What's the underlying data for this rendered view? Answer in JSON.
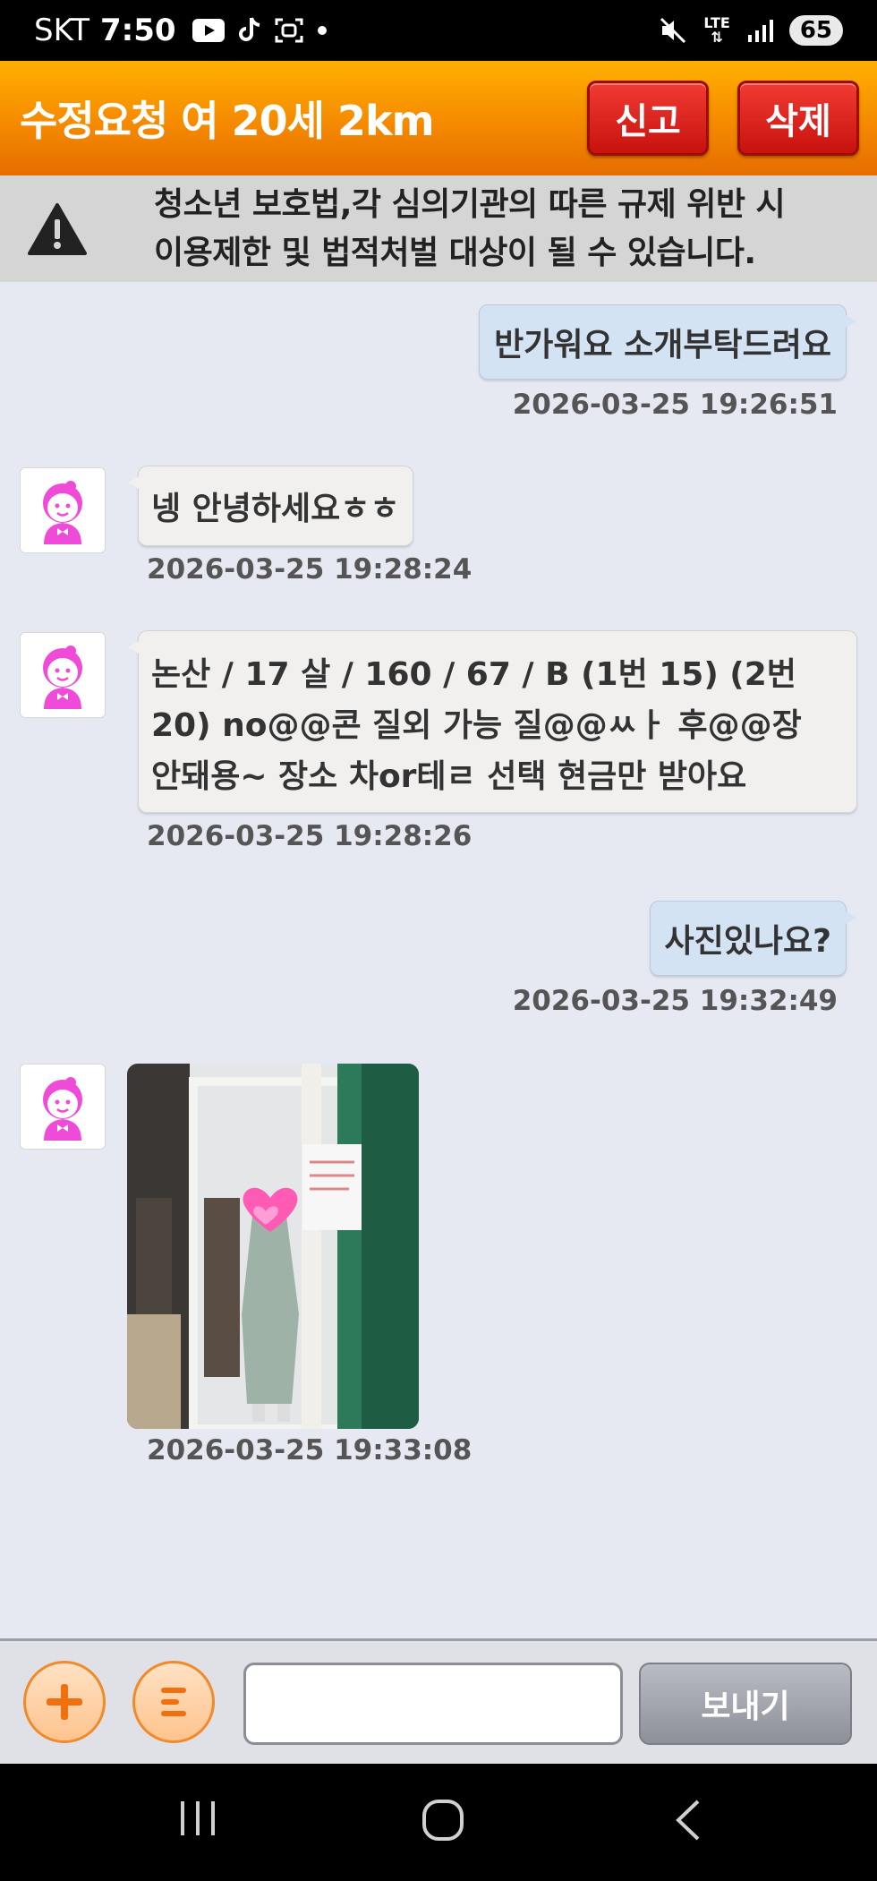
{
  "statusbar": {
    "carrier": "SKT",
    "time": "7:50",
    "network": "LTE",
    "battery": "65"
  },
  "header": {
    "title": "수정요청 여 20세 2km",
    "report_label": "신고",
    "delete_label": "삭제"
  },
  "warning": {
    "line1": "청소년 보호법,각 심의기관의 따른 규제 위반 시",
    "line2": "이용제한 및 법적처벌 대상이 될 수  있습니다."
  },
  "messages": [
    {
      "side": "sent",
      "text": "반가워요 소개부탁드려요",
      "time": "2026-03-25 19:26:51"
    },
    {
      "side": "received",
      "text": "넹 안녕하세요ㅎㅎ",
      "time": "2026-03-25 19:28:24"
    },
    {
      "side": "received",
      "lines": [
        "논산 / 17 살 / 160 / 67 / B (1번 15) (2번",
        "20) no@@콘 질외 가능 질@@ㅆㅏ 후@@장",
        "안돼용~ 장소 차or테ㄹ 선택 현금만 받아요"
      ],
      "time": "2026-03-25 19:28:26"
    },
    {
      "side": "sent",
      "text": "사진있나요?",
      "time": "2026-03-25 19:32:49"
    },
    {
      "side": "received",
      "type": "photo",
      "time": "2026-03-25 19:33:08"
    }
  ],
  "inputbar": {
    "input_value": "",
    "send_label": "보내기"
  },
  "colors": {
    "header_orange": "#f58a00",
    "delete_red": "#d81a14",
    "sent_bubble": "#d4e3f4",
    "received_bubble": "#f1f0ef"
  }
}
